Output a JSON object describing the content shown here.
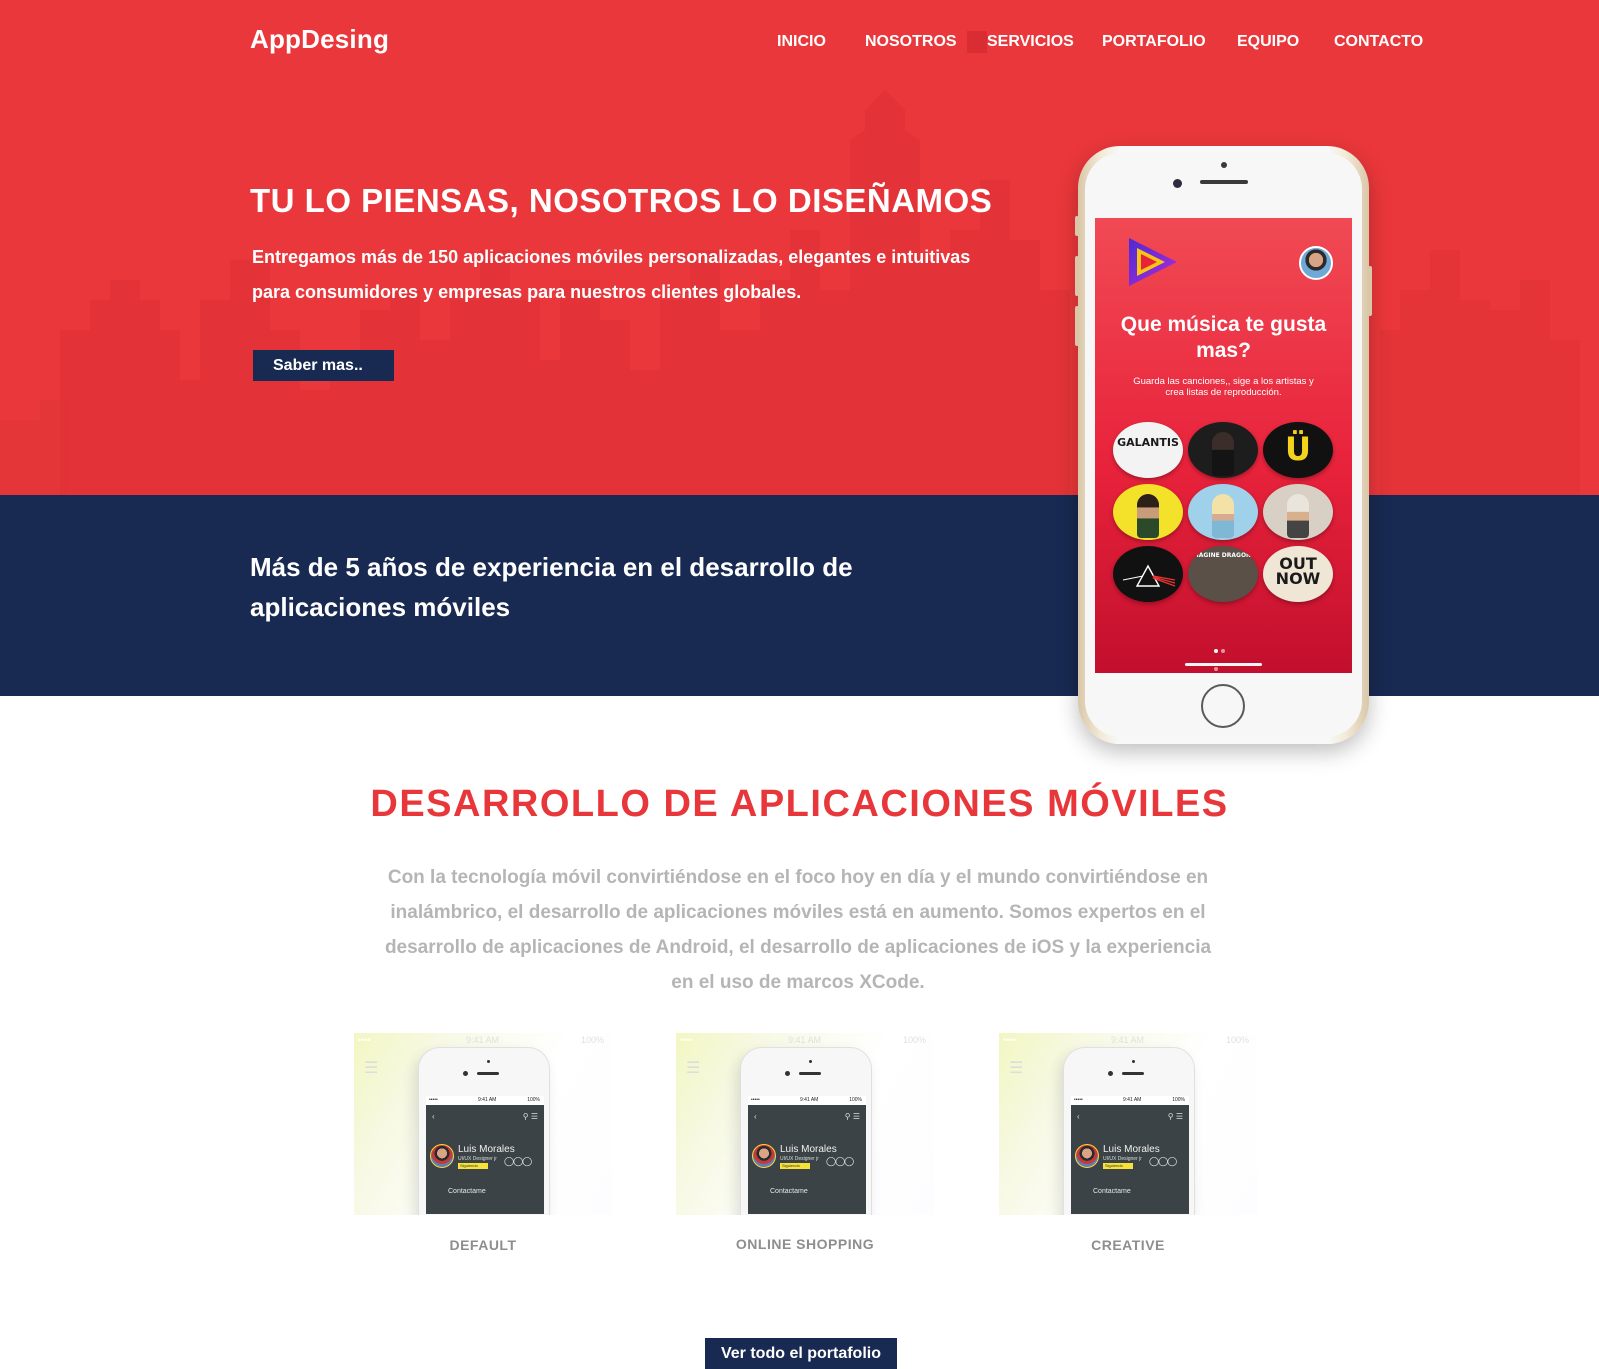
{
  "header": {
    "brand": "AppDesing",
    "nav": [
      {
        "label": "INICIO"
      },
      {
        "label": "NOSOTROS"
      },
      {
        "label": "SERVICIOS"
      },
      {
        "label": "PORTAFOLIO"
      },
      {
        "label": "EQUIPO"
      },
      {
        "label": "CONTACTO"
      }
    ],
    "active_nav": "SERVICIOS"
  },
  "hero": {
    "title": "TU LO PIENSAS, NOSOTROS LO DISEÑAMOS",
    "text": "Entregamos más de 150 aplicaciones móviles personalizadas, elegantes e intuitivas para consumidores y empresas para nuestros clientes globales.",
    "button": "Saber mas.."
  },
  "band": {
    "text": "Más de 5 años de experiencia en el desarrollo de aplicaciones móviles"
  },
  "phone_screen": {
    "title": "Que música te gusta mas?",
    "subtitle": "Guarda las canciones,, sige a los artistas y crea listas de reproducción.",
    "albums": [
      {
        "text": "GALANTIS",
        "bg": "#f3f3f3",
        "fg": "#1a1a1a"
      },
      {
        "text": "",
        "bg": "#1d1d1d",
        "fg": "#ffffff"
      },
      {
        "text": "Ü",
        "bg": "#111111",
        "fg": "#f5d21b"
      },
      {
        "text": "",
        "bg": "#f3e12a",
        "fg": "#222222"
      },
      {
        "text": "",
        "bg": "#9fd2ea",
        "fg": "#ffffff"
      },
      {
        "text": "",
        "bg": "#d8d0c4",
        "fg": "#333333"
      },
      {
        "text": "",
        "bg": "#111111",
        "fg": "#ffffff"
      },
      {
        "text": "IMAGINE DRAGONS",
        "bg": "#5a5048",
        "fg": "#ffffff"
      },
      {
        "text": "OUT NOW",
        "bg": "#efe6d6",
        "fg": "#1a1a1a"
      }
    ]
  },
  "services": {
    "title": "DESARROLLO DE APLICACIONES MÓVILES",
    "text": "Con la tecnología móvil convirtiéndose en el foco hoy en día y el mundo convirtiéndose en inalámbrico, el desarrollo de aplicaciones móviles está en aumento. Somos expertos en el desarrollo de aplicaciones de Android, el desarrollo de aplicaciones de iOS y la experiencia en el uso de marcos XCode.",
    "cards": [
      {
        "label": "DEFAULT",
        "status_left": "•••• ",
        "status_center": "9:41 AM",
        "status_right": "100%",
        "screen_time": "9:41 AM",
        "screen_battery": "100%",
        "screen_carrier": "•••••",
        "profile_name": "Luis Morales",
        "profile_role": "UI/UX Designer jr",
        "profile_badge": "Siguiendo",
        "contact": "Contactame"
      },
      {
        "label": "ONLINE SHOPPING",
        "status_left": "•••• ",
        "status_center": "9:41 AM",
        "status_right": "100%",
        "screen_time": "9:41 AM",
        "screen_battery": "100%",
        "screen_carrier": "•••••",
        "profile_name": "Luis Morales",
        "profile_role": "UI/UX Designer jr",
        "profile_badge": "Siguiendo",
        "contact": "Contactame"
      },
      {
        "label": "CREATIVE",
        "status_left": "•••• ",
        "status_center": "9:41 AM",
        "status_right": "100%",
        "screen_time": "9:41 AM",
        "screen_battery": "100%",
        "screen_carrier": "•••••",
        "profile_name": "Luis Morales",
        "profile_role": "UI/UX Designer jr",
        "profile_badge": "Siguiendo",
        "contact": "Contactame"
      }
    ],
    "portfolio_button": "Ver todo el portafolio"
  },
  "colors": {
    "red": "#ea373b",
    "navy": "#182a52",
    "title_red": "#e8373b",
    "muted_text": "#b5b5b5"
  }
}
